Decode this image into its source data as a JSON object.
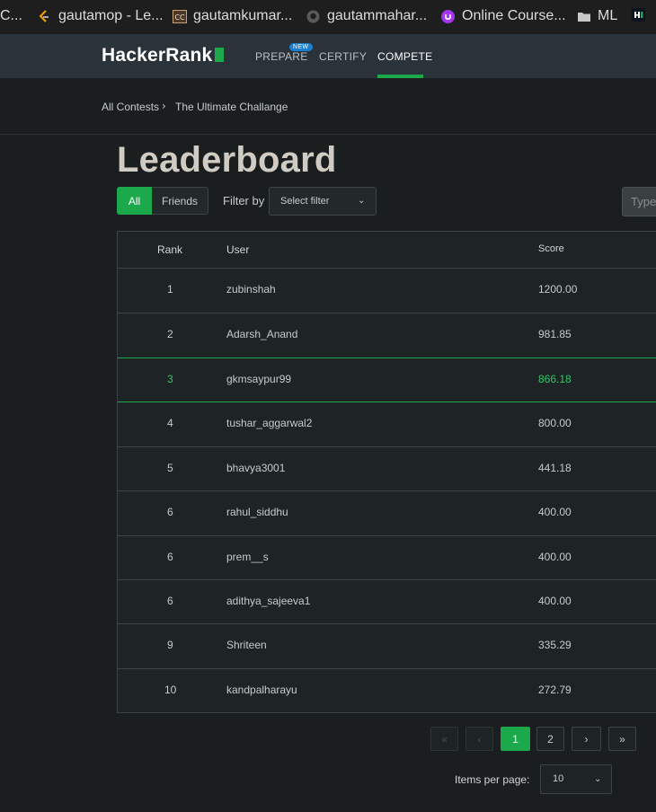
{
  "bookmarks": [
    {
      "label": "C...",
      "icon": "bookmark-partial-icon"
    },
    {
      "label": "gautamop - Le...",
      "icon": "leetcode-icon"
    },
    {
      "label": "gautamkumar...",
      "icon": "codechef-icon"
    },
    {
      "label": "gautammahar...",
      "icon": "github-icon"
    },
    {
      "label": "Online Course...",
      "icon": "udemy-icon"
    },
    {
      "label": "ML",
      "icon": "folder-icon"
    }
  ],
  "nav": {
    "logo": "HackerRank",
    "prepare": "PREPARE",
    "new_badge": "NEW",
    "certify": "CERTIFY",
    "compete": "COMPETE"
  },
  "breadcrumb": {
    "all_contests": "All Contests",
    "separator": "›",
    "contest": "The Ultimate Challange"
  },
  "page_title": "Leaderboard",
  "toolbar": {
    "all": "All",
    "friends": "Friends",
    "filter_label": "Filter by",
    "filter_placeholder": "Select filter",
    "search_placeholder": "Type"
  },
  "table": {
    "headers": {
      "rank": "Rank",
      "user": "User",
      "score": "Score"
    },
    "rows": [
      {
        "rank": "1",
        "user": "zubinshah",
        "score": "1200.00"
      },
      {
        "rank": "2",
        "user": "Adarsh_Anand",
        "score": "981.85"
      },
      {
        "rank": "3",
        "user": "gkmsaypur99",
        "score": "866.18"
      },
      {
        "rank": "4",
        "user": "tushar_aggarwal2",
        "score": "800.00"
      },
      {
        "rank": "5",
        "user": "bhavya3001",
        "score": "441.18"
      },
      {
        "rank": "6",
        "user": "rahul_siddhu",
        "score": "400.00"
      },
      {
        "rank": "6",
        "user": "prem__s",
        "score": "400.00"
      },
      {
        "rank": "6",
        "user": "adithya_sajeeva1",
        "score": "400.00"
      },
      {
        "rank": "9",
        "user": "Shriteen",
        "score": "335.29"
      },
      {
        "rank": "10",
        "user": "kandpalharayu",
        "score": "272.79"
      }
    ]
  },
  "pagination": {
    "first": "«",
    "prev": "‹",
    "page1": "1",
    "page2": "2",
    "next": "›",
    "last": "»",
    "items_per_page_label": "Items per page:",
    "items_per_page_value": "10"
  },
  "colors": {
    "accent": "#1ba94c",
    "highlight_text": "#2ec866",
    "nav_bg": "#2b333a",
    "page_bg": "#1a1e1f"
  }
}
